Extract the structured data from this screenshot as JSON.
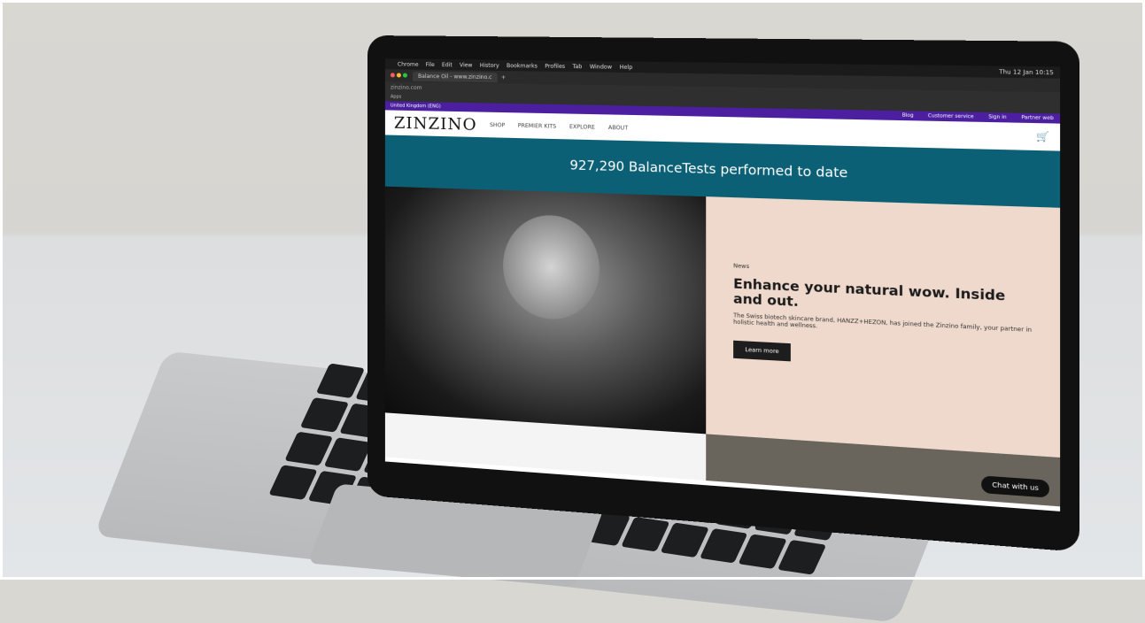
{
  "mac_menubar": {
    "items": [
      "Chrome",
      "File",
      "Edit",
      "View",
      "History",
      "Bookmarks",
      "Profiles",
      "Tab",
      "Window",
      "Help"
    ],
    "clock": "Thu 12 Jan 10:15"
  },
  "browser": {
    "tab_title": "Balance Oil - www.zinzino.c",
    "address": "zinzino.com",
    "bookmark": "Apps"
  },
  "site": {
    "region_label": "United Kingdom (ENG)",
    "top_links": [
      "Blog",
      "Customer service",
      "Sign in",
      "Partner web"
    ],
    "logo": "ZINZINO",
    "nav": [
      "SHOP",
      "PREMIER KITS",
      "EXPLORE",
      "ABOUT"
    ],
    "banner_text": "927,290 BalanceTests performed to date",
    "hero": {
      "tag": "News",
      "title": "Enhance your natural wow. Inside and out.",
      "body": "The Swiss biotech skincare brand, HANZZ+HEZON, has joined the Zinzino family, your partner in holistic health and wellness.",
      "button": "Learn more"
    },
    "chat_button": "Chat with us"
  },
  "colors": {
    "teal_banner": "#0c6075",
    "purple_bar": "#4b1fa0",
    "hero_panel": "#efd9cc"
  }
}
